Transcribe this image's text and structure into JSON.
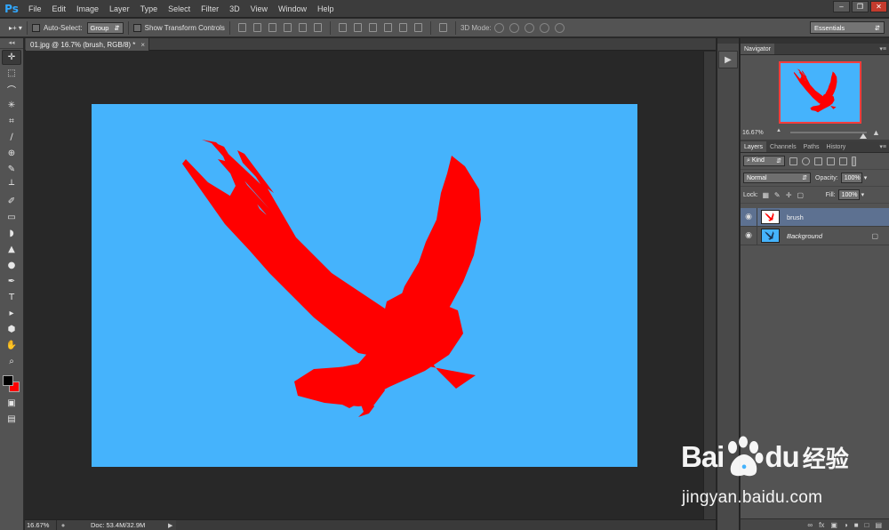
{
  "app": {
    "logo": "Ps"
  },
  "menu": [
    "File",
    "Edit",
    "Image",
    "Layer",
    "Type",
    "Select",
    "Filter",
    "3D",
    "View",
    "Window",
    "Help"
  ],
  "window_controls": {
    "minimize": "–",
    "restore": "❐",
    "close": "✕"
  },
  "options_bar": {
    "move_tool": "▸+ ▾",
    "auto_select_label": "Auto-Select:",
    "auto_select_value": "Group",
    "transform_label": "Show Transform Controls",
    "mode3d_label": "3D Mode:",
    "workspace": "Essentials"
  },
  "document": {
    "tab_title": "01.jpg @ 16.7% (brush, RGB/8) *",
    "close": "×",
    "canvas_color": "#45b3fc",
    "bird_color": "#ff0000"
  },
  "status": {
    "zoom": "16.67%",
    "doc": "Doc: 53.4M/32.9M",
    "arrow": "▶"
  },
  "tools": {
    "grip": "◂◂",
    "items": [
      {
        "name": "move-tool-icon",
        "glyph": "✛"
      },
      {
        "name": "marquee-tool-icon",
        "glyph": "⬚"
      },
      {
        "name": "lasso-tool-icon",
        "glyph": "⌒"
      },
      {
        "name": "quick-select-tool-icon",
        "glyph": "✳"
      },
      {
        "name": "crop-tool-icon",
        "glyph": "⌗"
      },
      {
        "name": "eyedropper-tool-icon",
        "glyph": "∕"
      },
      {
        "name": "healing-brush-tool-icon",
        "glyph": "⊕"
      },
      {
        "name": "brush-tool-icon",
        "glyph": "✎"
      },
      {
        "name": "clone-stamp-tool-icon",
        "glyph": "┴"
      },
      {
        "name": "history-brush-tool-icon",
        "glyph": "✐"
      },
      {
        "name": "eraser-tool-icon",
        "glyph": "▭"
      },
      {
        "name": "paint-bucket-tool-icon",
        "glyph": "◗"
      },
      {
        "name": "blur-tool-icon",
        "glyph": "▲"
      },
      {
        "name": "dodge-tool-icon",
        "glyph": "●"
      },
      {
        "name": "pen-tool-icon",
        "glyph": "✒"
      },
      {
        "name": "type-tool-icon",
        "glyph": "T"
      },
      {
        "name": "path-select-tool-icon",
        "glyph": "▸"
      },
      {
        "name": "shape-tool-icon",
        "glyph": "⬢"
      },
      {
        "name": "hand-tool-icon",
        "glyph": "✋"
      },
      {
        "name": "zoom-tool-icon",
        "glyph": "⌕"
      }
    ],
    "foreground_color": "#000000",
    "background_color": "#ff0000",
    "quick_mask_icon": "▣",
    "screen_mode_icon": "▤"
  },
  "panel_strip": {
    "play": "▶"
  },
  "navigator": {
    "tab": "Navigator",
    "menu": "▾≡",
    "zoom": "16.67%",
    "zoom_out": "▲",
    "zoom_in": "▲",
    "frame_color": "#ff3d3d",
    "view_fraction": 0.95
  },
  "layers_panel": {
    "tabs": [
      "Layers",
      "Channels",
      "Paths",
      "History"
    ],
    "menu": "▾≡",
    "kind": "Kind",
    "blend_mode": "Normal",
    "opacity_label": "Opacity:",
    "opacity": "100%",
    "lock_label": "Lock:",
    "fill_label": "Fill:",
    "fill": "100%",
    "filter_glyph": "⌕",
    "lock_icons": [
      "▦",
      "✎",
      "✛",
      "▢"
    ],
    "layers": [
      {
        "name": "brush",
        "selected": true
      },
      {
        "name": "Background",
        "selected": false,
        "locked": true
      }
    ],
    "eye": "◉",
    "lock": "▢",
    "footer": [
      "∞",
      "fx",
      "▣",
      "◑",
      "■",
      "□",
      "▤"
    ]
  },
  "watermark": {
    "brand_a": "Bai",
    "brand_b": "du",
    "cn": "经验",
    "url": "jingyan.baidu.com"
  }
}
